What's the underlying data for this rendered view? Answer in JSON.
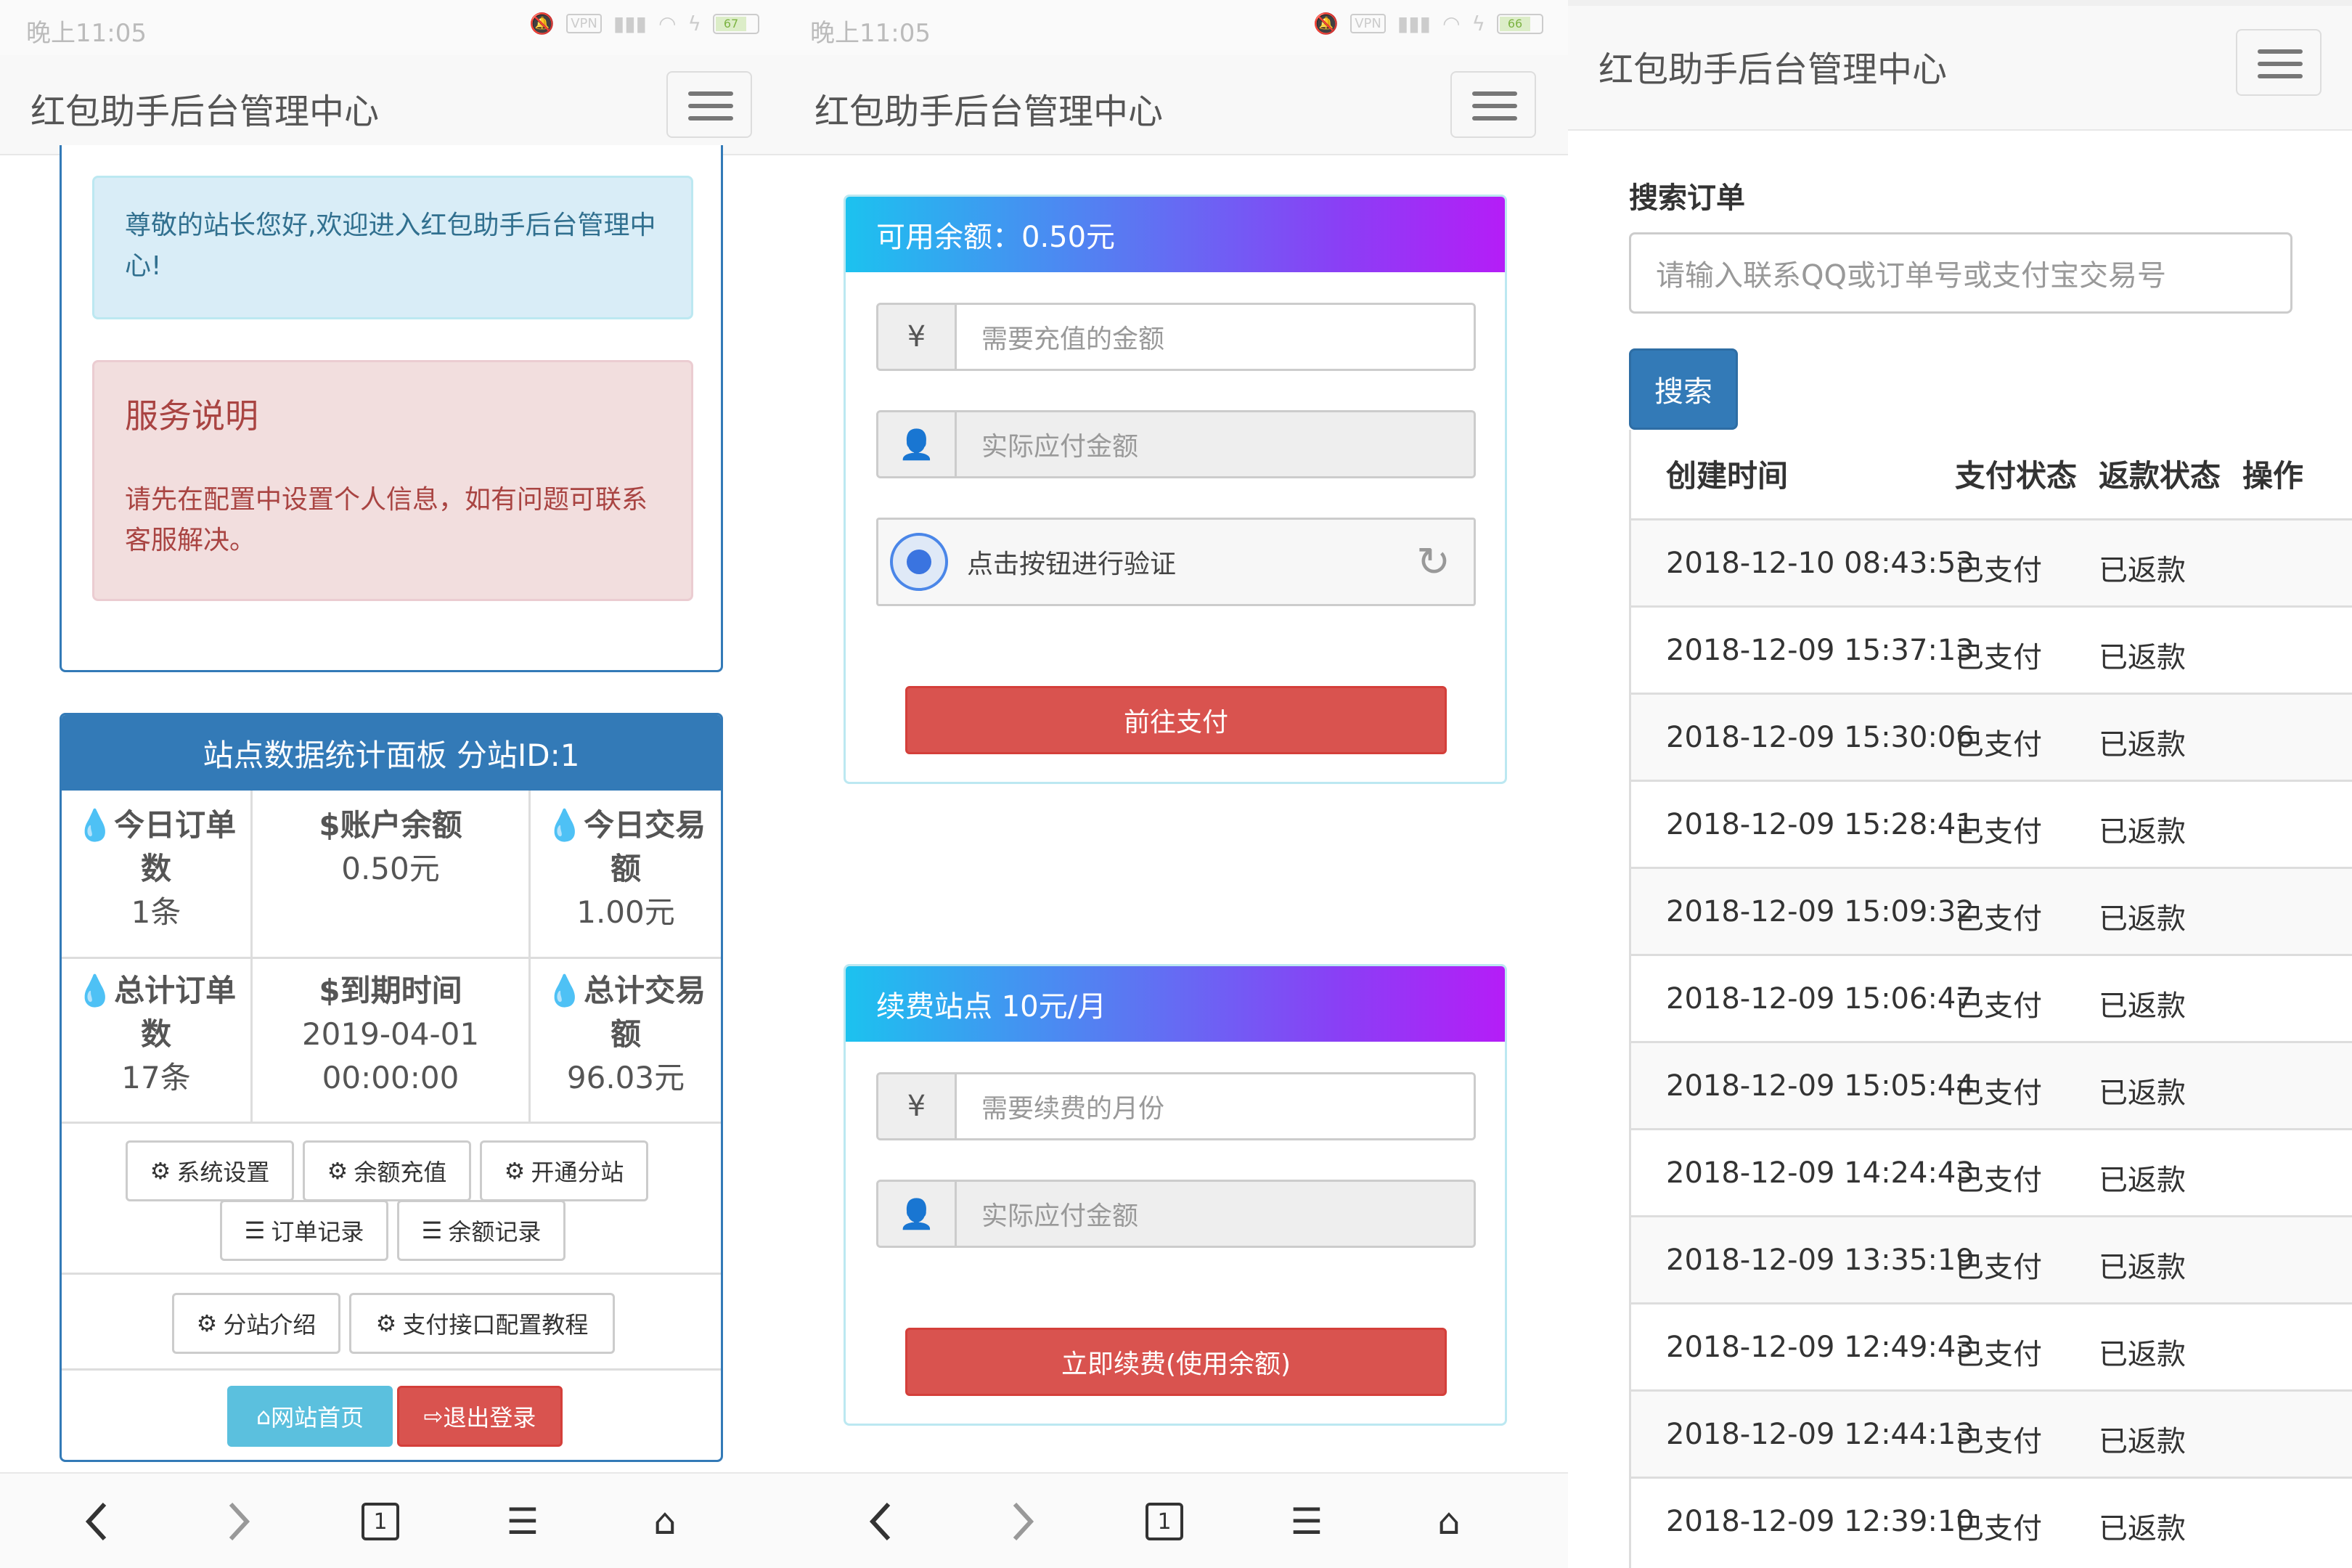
{
  "status_bar": [
    {
      "time": "晚上11:05",
      "vpn": "VPN",
      "battery": "67"
    },
    {
      "time": "晚上11:05",
      "vpn": "VPN",
      "battery": "66"
    }
  ],
  "brand": "红包助手后台管理中心",
  "panel1": {
    "welcome": "尊敬的站长您好,欢迎进入红包助手后台管理中心!",
    "service_title": "服务说明",
    "service_text": "请先在配置中设置个人信息，如有问题可联系客服解决。",
    "stats_header": "站点数据统计面板 分站ID:1",
    "stats": [
      {
        "icon": "drop-icon",
        "label": "今日订单数",
        "value": "1条"
      },
      {
        "icon": "dollar-icon",
        "label": "账户余额",
        "value": "0.50元"
      },
      {
        "icon": "drop-icon",
        "label": "今日交易额",
        "value": "1.00元"
      },
      {
        "icon": "drop-icon",
        "label": "总计订单数",
        "value": "17条"
      },
      {
        "icon": "dollar-icon",
        "label": "到期时间",
        "value": "2019-04-01 00:00:00"
      },
      {
        "icon": "drop-icon",
        "label": "总计交易额",
        "value": "96.03元"
      }
    ],
    "buttons": {
      "system_settings": "系统设置",
      "balance_recharge": "余额充值",
      "open_substation": "开通分站",
      "order_records": "订单记录",
      "balance_records": "余额记录",
      "substation_intro": "分站介绍",
      "payment_tutorial": "支付接口配置教程",
      "home": "网站首页",
      "logout": "退出登录"
    }
  },
  "panel2": {
    "balance_title": "可用余额：0.50元",
    "recharge_placeholder": "需要充值的金额",
    "actual_pay_placeholder": "实际应付金额",
    "captcha_text": "点击按钮进行验证",
    "pay_button": "前往支付",
    "renew_title": "续费站点 10元/月",
    "renew_months_placeholder": "需要续费的月份",
    "renew_actual_placeholder": "实际应付金额",
    "renew_button": "立即续费(使用余额)"
  },
  "panel3": {
    "search_label": "搜索订单",
    "search_placeholder": "请输入联系QQ或订单号或支付宝交易号",
    "search_button": "搜索",
    "columns": [
      "创建时间",
      "支付状态",
      "返款状态",
      "操作"
    ],
    "rows": [
      [
        "2018-12-10 08:43:53",
        "已支付",
        "已返款"
      ],
      [
        "2018-12-09 15:37:13",
        "已支付",
        "已返款"
      ],
      [
        "2018-12-09 15:30:06",
        "已支付",
        "已返款"
      ],
      [
        "2018-12-09 15:28:41",
        "已支付",
        "已返款"
      ],
      [
        "2018-12-09 15:09:32",
        "已支付",
        "已返款"
      ],
      [
        "2018-12-09 15:06:47",
        "已支付",
        "已返款"
      ],
      [
        "2018-12-09 15:05:44",
        "已支付",
        "已返款"
      ],
      [
        "2018-12-09 14:24:43",
        "已支付",
        "已返款"
      ],
      [
        "2018-12-09 13:35:19",
        "已支付",
        "已返款"
      ],
      [
        "2018-12-09 12:49:43",
        "已支付",
        "已返款"
      ],
      [
        "2018-12-09 12:44:13",
        "已支付",
        "已返款"
      ],
      [
        "2018-12-09 12:39:10",
        "已支付",
        "已返款"
      ]
    ]
  },
  "colors": {
    "primary": "#337ab7",
    "danger": "#d9534f",
    "info": "#5bc0de",
    "gradient_start": "#1cc2ef",
    "gradient_end": "#b51df7"
  }
}
